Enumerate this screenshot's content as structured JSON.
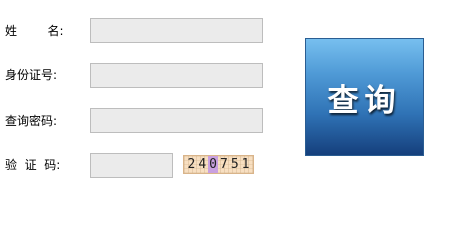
{
  "form": {
    "name_label": "姓        名:",
    "id_label": "身份证号:",
    "password_label": "查询密码:",
    "captcha_label": "验  证  码:",
    "name_value": "",
    "id_value": "",
    "password_value": "",
    "captcha_value": ""
  },
  "captcha": {
    "chars": [
      "2",
      "4",
      "0",
      "7",
      "5",
      "1"
    ],
    "highlight_index": 2
  },
  "query_button": {
    "label": "查询"
  },
  "colors": {
    "button_top": "#77bfef",
    "button_bottom": "#153f7c",
    "input_bg": "#ebebeb",
    "captcha_bg": "#f8dfc1"
  }
}
